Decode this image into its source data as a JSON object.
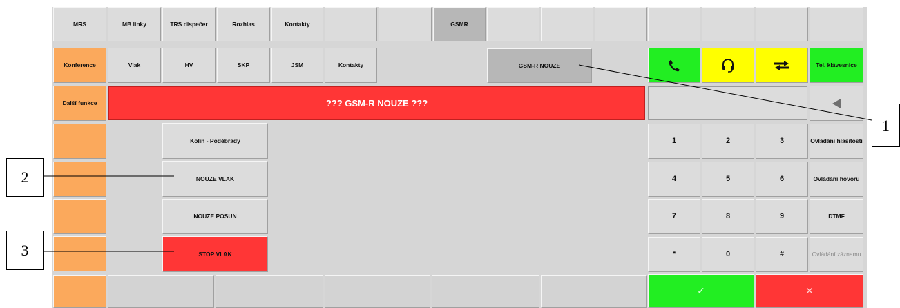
{
  "top_tabs": [
    "MRS",
    "MB linky",
    "TRS dispečer",
    "Rozhlas",
    "Kontakty",
    "",
    "",
    "GSMR",
    "",
    "",
    "",
    "",
    "",
    "",
    ""
  ],
  "sub_tabs": [
    "Vlak",
    "HV",
    "SKP",
    "JSM",
    "Kontakty"
  ],
  "gsmr_nouze_label": "GSM-R NOUZE",
  "left_column": {
    "konference": "Konference",
    "dalsi_funkce": "Další funkce"
  },
  "banner_text": "??? GSM-R NOUZE ???",
  "emergency_list": {
    "header": "Kolín - Poděbrady",
    "nouze_vlak": "NOUZE VLAK",
    "nouze_posun": "NOUZE POSUN",
    "stop_vlak": "STOP VLAK"
  },
  "call_icons": [
    "phone-icon",
    "headset-icon",
    "transfer-arrows-icon"
  ],
  "tel_klavesnice": "Tel. klávesnice",
  "keypad": [
    [
      "1",
      "2",
      "3"
    ],
    [
      "4",
      "5",
      "6"
    ],
    [
      "7",
      "8",
      "9"
    ],
    [
      "*",
      "0",
      "#"
    ]
  ],
  "side_functions": {
    "hlasitost": "Ovládání hlasitosti",
    "hovor": "Ovládání hovoru",
    "dtmf": "DTMF",
    "zaznam": "Ovládání záznamu"
  },
  "confirm_glyph": "✓",
  "cancel_glyph": "✕",
  "callouts": [
    "1",
    "2",
    "3"
  ],
  "colors": {
    "orange": "#fba95c",
    "green": "#22ee22",
    "yellow": "#ffff00",
    "red": "#ff3636",
    "selected": "#b7b7b7"
  }
}
